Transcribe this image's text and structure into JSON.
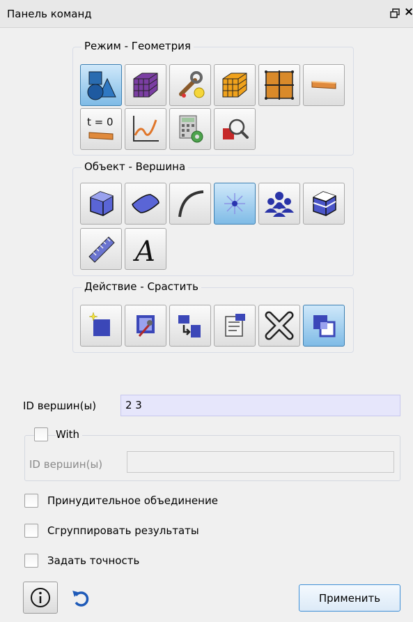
{
  "panel": {
    "title": "Панель команд"
  },
  "mode_group": {
    "title": "Режим - Геометрия"
  },
  "object_group": {
    "title": "Объект - Вершина"
  },
  "action_group": {
    "title": "Действие - Срастить"
  },
  "form": {
    "vertex_ids_label": "ID вершин(ы)",
    "vertex_ids_value": "2 3",
    "with_label": "With",
    "with_vertex_ids_label": "ID вершин(ы)",
    "with_vertex_ids_value": "",
    "force_merge_label": "Принудительное объединение",
    "group_results_label": "Сгруппировать результаты",
    "set_tolerance_label": "Задать точность"
  },
  "footer": {
    "apply_label": "Применить"
  },
  "icons": {
    "mode": [
      "geometry-icon",
      "mesh-icon",
      "tools-icon",
      "hex-mesh-icon",
      "blocks-grid-icon",
      "boundary-condition-icon",
      "initial-condition-icon",
      "analysis-plot-icon",
      "calculator-settings-icon",
      "examine-icon"
    ],
    "object": [
      "volume-icon",
      "surface-icon",
      "curve-icon",
      "vertex-icon",
      "group-icon",
      "body-icon",
      "measure-ruler-icon",
      "text-label-icon"
    ],
    "action": [
      "create-icon",
      "modify-icon",
      "transform-icon",
      "properties-icon",
      "delete-icon",
      "merge-icon"
    ]
  },
  "active": {
    "mode": "geometry-icon",
    "object": "vertex-icon",
    "action": "merge-icon"
  }
}
